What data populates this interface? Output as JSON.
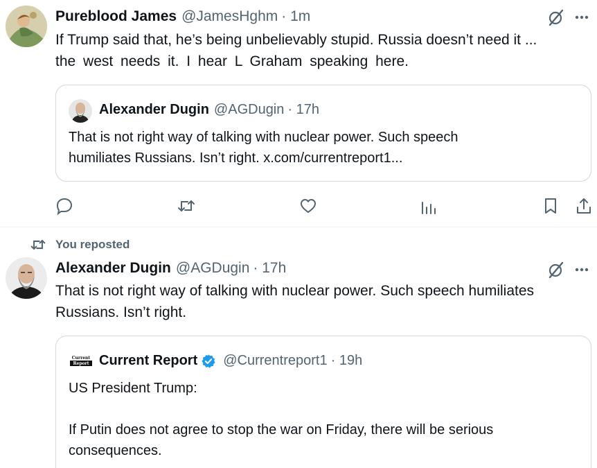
{
  "tweet1": {
    "author_name": "Pureblood James",
    "handle": "@JamesHghm",
    "time": "· 1m",
    "text_line1": "If Trump said that, he’s being unbelievably stupid. Russia doesn’t need it ...",
    "text_line2": "the west needs it. I hear L Graham speaking here.",
    "quote": {
      "author_name": "Alexander Dugin",
      "handle": "@AGDugin",
      "time": "· 17h",
      "text_line1": "That is not right way of talking with nuclear power. Such speech",
      "text_line2": "humiliates Russians. Isn’t right. x.com/currentreport1..."
    }
  },
  "repost_label": "You reposted",
  "tweet2": {
    "author_name": "Alexander Dugin",
    "handle": "@AGDugin",
    "time": "· 17h",
    "text_line1": "That is not right way of talking with nuclear power. Such speech humiliates",
    "text_line2": "Russians. Isn’t right.",
    "quote": {
      "logo_text": "Current Report",
      "author_name": "Current Report",
      "handle": "@Currentreport1",
      "time": "· 19h",
      "text_line1": "US President Trump:",
      "text_line2": "If Putin does not agree to stop the war on Friday, there will be serious",
      "text_line3": "consequences."
    }
  },
  "icons": {
    "grok": "grok-icon",
    "more": "more-icon",
    "reply": "reply-icon",
    "repost": "repost-icon",
    "like": "like-icon",
    "views": "views-icon",
    "bookmark": "bookmark-icon",
    "share": "share-icon",
    "verified": "verified-badge-icon"
  },
  "colors": {
    "text": "#0f1419",
    "secondary": "#536471",
    "border": "#cfd9de",
    "verified": "#1d9bf0"
  }
}
